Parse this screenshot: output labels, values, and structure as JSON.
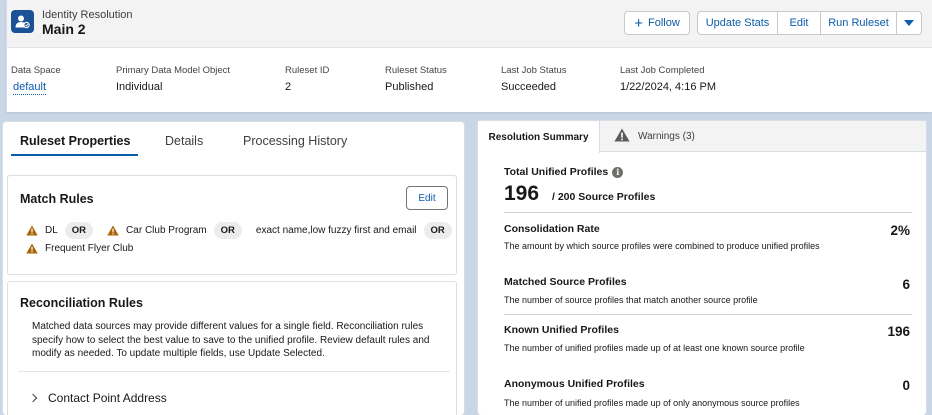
{
  "header": {
    "object_label": "Identity Resolution",
    "title": "Main 2",
    "icon": "identity-resolution-icon",
    "buttons": {
      "follow": "Follow",
      "update_stats": "Update Stats",
      "edit": "Edit",
      "run_ruleset": "Run Ruleset"
    },
    "fields": [
      {
        "label": "Data Space",
        "value": "default"
      },
      {
        "label": "Primary Data Model Object",
        "value": "Individual"
      },
      {
        "label": "Ruleset ID",
        "value": "2"
      },
      {
        "label": "Ruleset Status",
        "value": "Published"
      },
      {
        "label": "Last Job Status",
        "value": "Succeeded"
      },
      {
        "label": "Last Job Completed",
        "value": "1/22/2024, 4:16 PM"
      }
    ]
  },
  "left": {
    "tabs": [
      "Ruleset Properties",
      "Details",
      "Processing History"
    ],
    "match_rules": {
      "title": "Match Rules",
      "edit_label": "Edit",
      "rules": [
        "DL",
        "Car Club Program",
        "exact name,low fuzzy first and email",
        "Frequent Flyer Club"
      ],
      "separator": "OR"
    },
    "reconciliation": {
      "title": "Reconciliation Rules",
      "description": "Matched data sources may provide different values for a single field. Reconciliation rules specify how to select the best value to save to the unified profile. Review default rules and modify as needed. To update multiple fields, use Update Selected.",
      "accordion_item": "Contact Point Address"
    }
  },
  "right": {
    "tabs": {
      "summary": "Resolution Summary",
      "warnings": "Warnings (3)"
    },
    "total": {
      "label": "Total Unified Profiles",
      "count": "196",
      "source": "/ 200 Source Profiles"
    },
    "metrics": [
      {
        "name": "Consolidation Rate",
        "desc": "The amount by which source profiles were combined to produce unified profiles",
        "value": "2%"
      },
      {
        "name": "Matched Source Profiles",
        "desc": "The number of source profiles that match another source profile",
        "value": "6"
      },
      {
        "name": "Known Unified Profiles",
        "desc": "The number of unified profiles made up of at least one known source profile",
        "value": "196"
      },
      {
        "name": "Anonymous Unified Profiles",
        "desc": "The number of unified profiles made up of only anonymous source profiles",
        "value": "0"
      }
    ]
  },
  "colors": {
    "brand_blue": "#0b5cab",
    "icon_bg": "#1b5297",
    "warning": "#a96404",
    "page_bg": "#c9d6e6"
  }
}
